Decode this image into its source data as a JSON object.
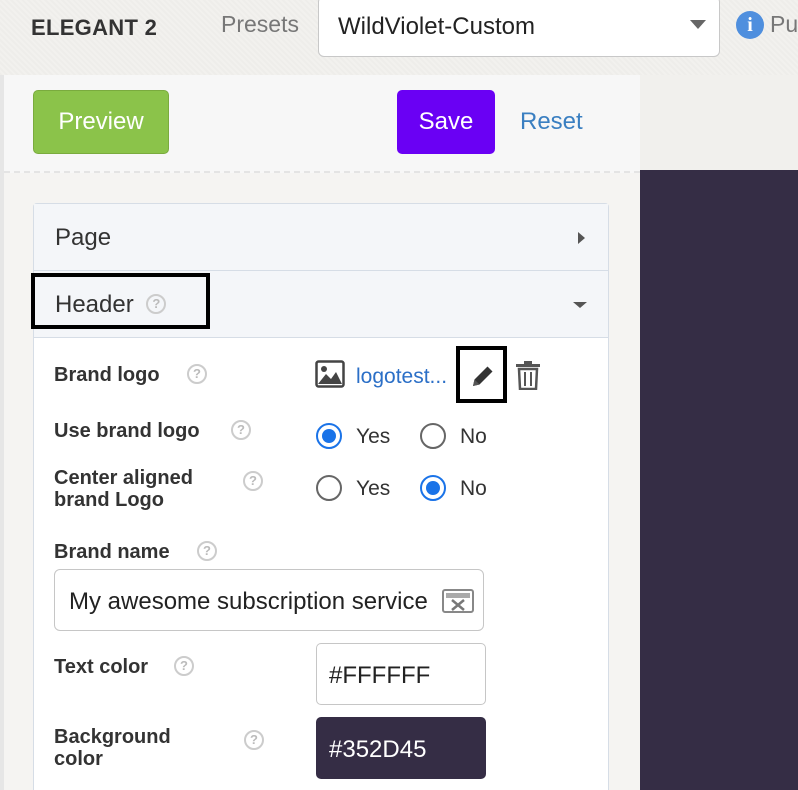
{
  "header": {
    "theme_name": "ELEGANT 2",
    "presets_label": "Presets",
    "preset_selected": "WildViolet-Custom",
    "publish_text": "Pu"
  },
  "actions": {
    "preview_label": "Preview",
    "save_label": "Save",
    "reset_label": "Reset"
  },
  "sections": [
    {
      "title": "Page"
    },
    {
      "title": "Header"
    }
  ],
  "header_settings": {
    "brand_logo": {
      "label": "Brand logo",
      "filename": "logotest..."
    },
    "use_brand_logo": {
      "label": "Use brand logo",
      "selected": "Yes",
      "options": [
        "Yes",
        "No"
      ]
    },
    "center_aligned_logo": {
      "label_line1": "Center aligned",
      "label_line2": "brand Logo",
      "selected": "No",
      "options": [
        "Yes",
        "No"
      ]
    },
    "brand_name": {
      "label": "Brand name",
      "value": "My awesome subscription service"
    },
    "text_color": {
      "label": "Text color",
      "value": "#FFFFFF"
    },
    "background_color": {
      "label_line1": "Background",
      "label_line2": "color",
      "value": "#352D45"
    }
  },
  "colors": {
    "preview_accent": "#8BC34A",
    "save_accent": "#6A00F4",
    "link": "#2B6FC7",
    "preview_pane_bg": "#352D45",
    "radio_selected": "#1A73E8"
  },
  "icons": {
    "info": "info-icon",
    "help": "question-mark-icon",
    "image": "image-icon",
    "edit": "pencil-icon",
    "delete": "trash-icon",
    "clear": "clear-input-icon"
  }
}
